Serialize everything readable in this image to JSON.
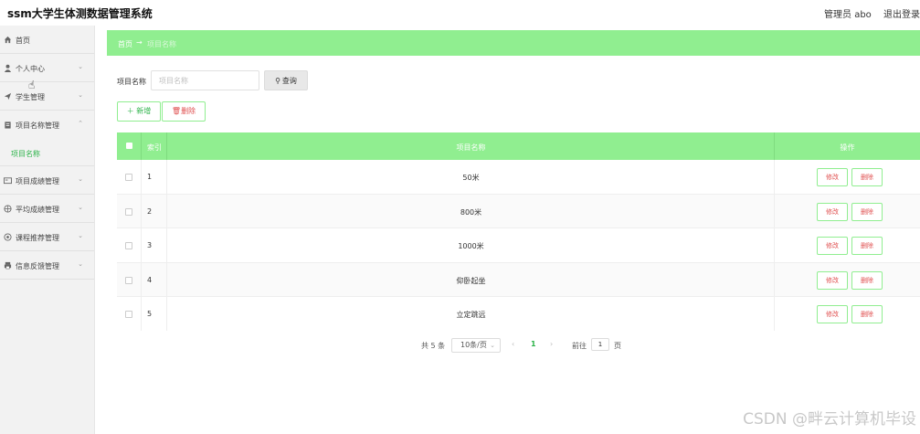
{
  "header": {
    "title": "ssm大学生体测数据管理系统",
    "user_label": "管理员 abo",
    "logout_label": "退出登录"
  },
  "sidebar": {
    "items": [
      {
        "label": "首页",
        "icon": "home-icon"
      },
      {
        "label": "个人中心",
        "icon": "user-icon"
      },
      {
        "label": "学生管理",
        "icon": "send-icon"
      },
      {
        "label": "项目名称管理",
        "icon": "clipboard-icon"
      },
      {
        "label": "项目成绩管理",
        "icon": "card-icon"
      },
      {
        "label": "平均成绩管理",
        "icon": "globe-icon"
      },
      {
        "label": "课程推荐管理",
        "icon": "compass-icon"
      },
      {
        "label": "信息反馈管理",
        "icon": "printer-icon"
      }
    ],
    "subitem": "项目名称"
  },
  "breadcrumb": {
    "home": "首页",
    "separator": "→",
    "current": "项目名称"
  },
  "search": {
    "label": "项目名称",
    "placeholder": "项目名称",
    "button_label": "查询"
  },
  "actions": {
    "add_label": "新增",
    "delete_label": "删除"
  },
  "table": {
    "columns": [
      "索引",
      "项目名称",
      "操作"
    ],
    "rows": [
      {
        "index": "1",
        "name": "50米"
      },
      {
        "index": "2",
        "name": "800米"
      },
      {
        "index": "3",
        "name": "1000米"
      },
      {
        "index": "4",
        "name": "仰卧起坐"
      },
      {
        "index": "5",
        "name": "立定跳远"
      }
    ],
    "edit_label": "修改",
    "remove_label": "删除"
  },
  "pagination": {
    "total": "共 5 条",
    "page_size": "10条/页",
    "current_page": "1",
    "goto_label": "前往",
    "goto_value": "1",
    "page_suffix": "页"
  },
  "watermark": "CSDN @畔云计算机毕设",
  "colors": {
    "accent": "#90ee90",
    "accent_text": "#2db34a",
    "danger": "#e05050"
  }
}
